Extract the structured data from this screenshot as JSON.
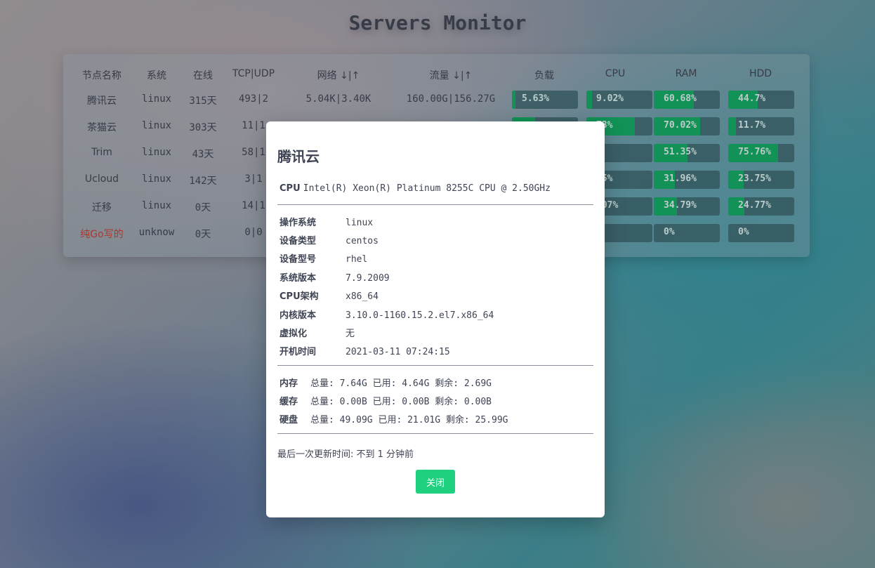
{
  "page_title": "Servers Monitor",
  "table": {
    "headers": [
      "节点名称",
      "系统",
      "在线",
      "TCP|UDP",
      "网络 ↓|↑",
      "流量 ↓|↑",
      "负载",
      "CPU",
      "RAM",
      "HDD"
    ],
    "rows": [
      {
        "name": "腾讯云",
        "os": "linux",
        "uptime": "315天",
        "tcp_udp": "493|2",
        "network": "5.04K|3.40K",
        "traffic": "160.00G|156.27G",
        "load": {
          "text": "5.63%",
          "pct": 5.63
        },
        "cpu": {
          "text": "9.02%",
          "pct": 9.02
        },
        "ram": {
          "text": "60.68%",
          "pct": 60.68
        },
        "hdd": {
          "text": "44.7%",
          "pct": 44.7
        },
        "status": "online"
      },
      {
        "name": "茶猫云",
        "os": "linux",
        "uptime": "303天",
        "tcp_udp": "11|1",
        "network": "",
        "traffic": "",
        "load": {
          "text": "",
          "pct": 35
        },
        "cpu": {
          "text": "73%",
          "pct": 73
        },
        "ram": {
          "text": "70.02%",
          "pct": 70.02
        },
        "hdd": {
          "text": "11.7%",
          "pct": 11.7
        },
        "status": "online"
      },
      {
        "name": "Trim",
        "os": "linux",
        "uptime": "43天",
        "tcp_udp": "58|1",
        "network": "",
        "traffic": "",
        "load": {
          "text": "",
          "pct": 0
        },
        "cpu": {
          "text": "%",
          "pct": 0
        },
        "ram": {
          "text": "51.35%",
          "pct": 51.35
        },
        "hdd": {
          "text": "75.76%",
          "pct": 75.76
        },
        "status": "online"
      },
      {
        "name": "Ucloud",
        "os": "linux",
        "uptime": "142天",
        "tcp_udp": "3|1",
        "network": "",
        "traffic": "",
        "load": {
          "text": "",
          "pct": 0
        },
        "cpu": {
          "text": ".5%",
          "pct": 0
        },
        "ram": {
          "text": "31.96%",
          "pct": 31.96
        },
        "hdd": {
          "text": "23.75%",
          "pct": 23.75
        },
        "status": "online"
      },
      {
        "name": "迁移",
        "os": "linux",
        "uptime": "0天",
        "tcp_udp": "14|1",
        "network": "",
        "traffic": "",
        "load": {
          "text": "",
          "pct": 0
        },
        "cpu": {
          "text": ".07%",
          "pct": 0
        },
        "ram": {
          "text": "34.79%",
          "pct": 34.79
        },
        "hdd": {
          "text": "24.77%",
          "pct": 24.77
        },
        "status": "online"
      },
      {
        "name": "纯Go写的",
        "os": "unknow",
        "uptime": "0天",
        "tcp_udp": "0|0",
        "network": "",
        "traffic": "",
        "load": {
          "text": "",
          "pct": 0
        },
        "cpu": {
          "text": "%",
          "pct": 0
        },
        "ram": {
          "text": "0%",
          "pct": 0
        },
        "hdd": {
          "text": "0%",
          "pct": 0
        },
        "status": "offline"
      }
    ]
  },
  "modal": {
    "title": "腾讯云",
    "cpu_label": "CPU",
    "cpu_value": "Intel(R) Xeon(R) Platinum 8255C CPU @ 2.50GHz",
    "details": [
      {
        "label": "操作系统",
        "value": "linux"
      },
      {
        "label": "设备类型",
        "value": "centos"
      },
      {
        "label": "设备型号",
        "value": "rhel"
      },
      {
        "label": "系统版本",
        "value": "7.9.2009"
      },
      {
        "label": "CPU架构",
        "value": "x86_64"
      },
      {
        "label": "内核版本",
        "value": "3.10.0-1160.15.2.el7.x86_64"
      },
      {
        "label": "虚拟化",
        "value": "无"
      },
      {
        "label": "开机时间",
        "value": "2021-03-11 07:24:15"
      }
    ],
    "memory": [
      {
        "label": "内存",
        "value": "总量: 7.64G 已用: 4.64G 剩余: 2.69G"
      },
      {
        "label": "缓存",
        "value": "总量: 0.00B 已用: 0.00B 剩余: 0.00B"
      },
      {
        "label": "硬盘",
        "value": "总量: 49.09G 已用: 21.01G 剩余: 25.99G"
      }
    ],
    "last_update": "最后一次更新时间: 不到 1 分钟前",
    "close_label": "关闭"
  },
  "colors": {
    "bar_fill": "#0fa15a",
    "bar_track": "#375f64",
    "offline_text": "#c0392b",
    "close_button": "#1fd17f"
  }
}
